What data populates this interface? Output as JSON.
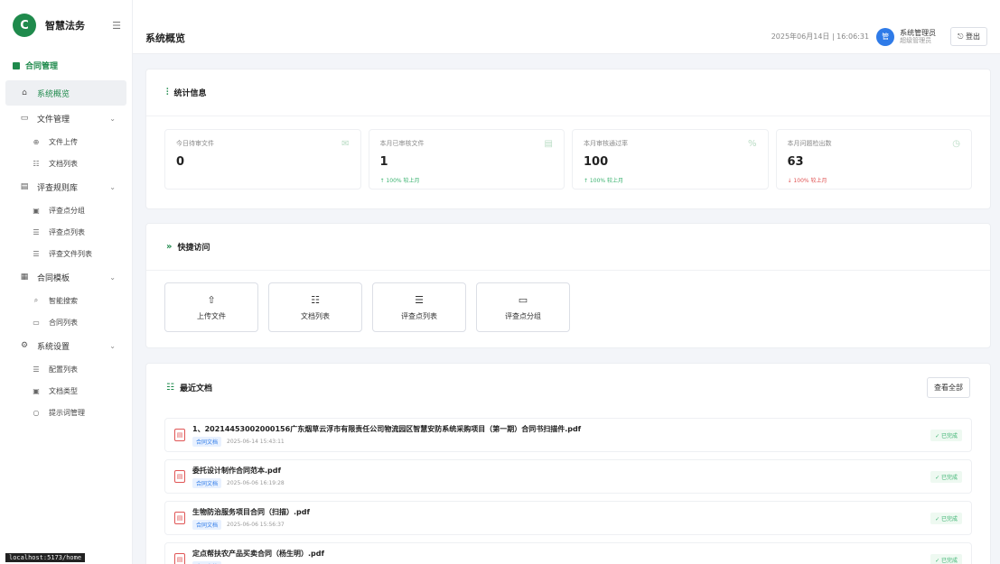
{
  "app": {
    "name": "智慧法务",
    "logo_letter": "C"
  },
  "sidebar": {
    "section": "合同管理",
    "items": [
      {
        "label": "系统概览",
        "icon": "home-icon",
        "glyph": "⌂",
        "active": true
      },
      {
        "label": "文件管理",
        "icon": "folder-icon",
        "glyph": "▭",
        "expandable": true,
        "children": [
          {
            "label": "文件上传",
            "glyph": "⊕"
          },
          {
            "label": "文档列表",
            "glyph": "☷"
          }
        ]
      },
      {
        "label": "评查规则库",
        "icon": "book-icon",
        "glyph": "▤",
        "expandable": true,
        "children": [
          {
            "label": "评查点分组",
            "glyph": "▣"
          },
          {
            "label": "评查点列表",
            "glyph": "☰"
          },
          {
            "label": "评查文件列表",
            "glyph": "☰"
          }
        ]
      },
      {
        "label": "合同模板",
        "icon": "template-icon",
        "glyph": "▦",
        "expandable": true,
        "children": [
          {
            "label": "智能搜索",
            "glyph": "⌕"
          },
          {
            "label": "合同列表",
            "glyph": "▭"
          }
        ]
      },
      {
        "label": "系统设置",
        "icon": "settings-icon",
        "glyph": "⚙",
        "expandable": true,
        "children": [
          {
            "label": "配置列表",
            "glyph": "☰"
          },
          {
            "label": "文档类型",
            "glyph": "▣"
          },
          {
            "label": "提示词管理",
            "glyph": "○"
          }
        ]
      }
    ]
  },
  "url_tip": "localhost:5173/home",
  "header": {
    "title": "系统概览",
    "datetime": "2025年06月14日 | 16:06:31",
    "avatar_letter": "管",
    "user_name": "系统管理员",
    "user_role": "超级管理员",
    "logout": "登出"
  },
  "stats_card": {
    "title": "统计信息",
    "stats": [
      {
        "label": "今日待审文件",
        "value": "0",
        "trend": "",
        "icon_glyph": "✉"
      },
      {
        "label": "本月已审核文件",
        "value": "1",
        "trend": "↑ 100% 较上月",
        "icon_glyph": "▤"
      },
      {
        "label": "本月审核通过率",
        "value": "100",
        "trend": "↑ 100% 较上月",
        "icon_glyph": "%"
      },
      {
        "label": "本月问题检出数",
        "value": "63",
        "trend": "↓ 100% 较上月",
        "icon_glyph": "◷"
      }
    ]
  },
  "quick_card": {
    "title": "快捷访问",
    "buttons": [
      {
        "label": "上传文件",
        "glyph": "⇧"
      },
      {
        "label": "文档列表",
        "glyph": "☷"
      },
      {
        "label": "评查点列表",
        "glyph": "☰"
      },
      {
        "label": "评查点分组",
        "glyph": "▭"
      }
    ]
  },
  "recent_card": {
    "title": "最近文档",
    "view_all": "查看全部",
    "docs": [
      {
        "title": "1、20214453002000156广东烟草云浮市有限责任公司物流园区智慧安防系统采购项目（第一期）合同书扫描件.pdf",
        "tag": "合同文档",
        "time": "2025-06-14 15:43:11",
        "status": "✓ 已完成"
      },
      {
        "title": "委托设计制作合同范本.pdf",
        "tag": "合同文档",
        "time": "2025-06-06 16:19:28",
        "status": "✓ 已完成"
      },
      {
        "title": "生物防治服务项目合同（扫描）.pdf",
        "tag": "合同文档",
        "time": "2025-06-06 15:56:37",
        "status": "✓ 已完成"
      },
      {
        "title": "定点帮扶农产品买卖合同（杨生明）.pdf",
        "tag": "合同文档",
        "time": "",
        "status": "✓ 已完成"
      }
    ]
  },
  "colors": {
    "brand": "#1f8a4c",
    "accent": "#2f7be8",
    "success": "#3cb371",
    "danger": "#e05555"
  }
}
